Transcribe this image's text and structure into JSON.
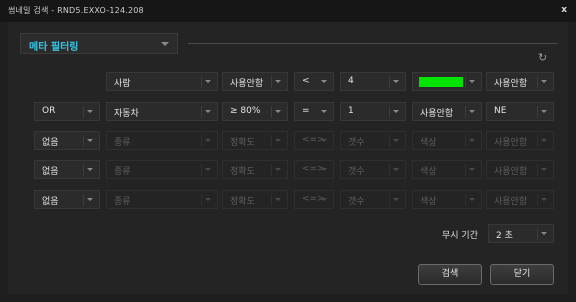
{
  "window": {
    "title": "썸네일 검색 - RND5.EXXO-124.208",
    "close_label": "x"
  },
  "meta_filter": {
    "label": "메타 필터링"
  },
  "refresh_icon": "refresh-icon",
  "rows": [
    {
      "logic": "",
      "object": "사람",
      "accuracy": "사용안함",
      "operator": "<",
      "count": "4",
      "color": "#00e400",
      "extra": "사용안함"
    },
    {
      "logic": "OR",
      "object": "자동차",
      "accuracy": "≥ 80%",
      "operator": "=",
      "count": "1",
      "color_text": "사용안함",
      "extra": "NE"
    },
    {
      "logic": "없음",
      "object": "종류",
      "accuracy": "정확도",
      "operator": "<=>",
      "count": "갯수",
      "color_text": "색상",
      "extra": "사용안함"
    },
    {
      "logic": "없음",
      "object": "종류",
      "accuracy": "정확도",
      "operator": "<=>",
      "count": "갯수",
      "color_text": "색상",
      "extra": "사용안함"
    },
    {
      "logic": "없음",
      "object": "종류",
      "accuracy": "정확도",
      "operator": "<=>",
      "count": "갯수",
      "color_text": "색상",
      "extra": "사용안함"
    }
  ],
  "ignore_duration": {
    "label": "무시 기간",
    "value": "2 초"
  },
  "buttons": {
    "search": "검색",
    "close": "닫기"
  }
}
